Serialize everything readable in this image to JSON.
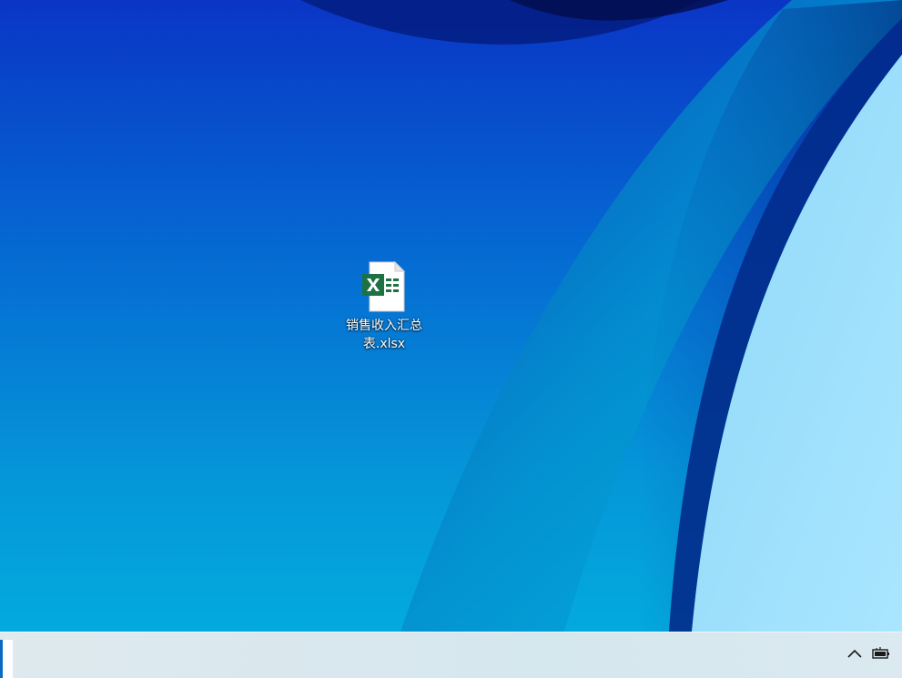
{
  "desktop": {
    "icons": [
      {
        "label": "销售收入汇总表.xlsx",
        "icon_name": "excel-file-icon",
        "brand_color": "#1e7145"
      }
    ]
  },
  "taskbar": {
    "tray": [
      {
        "icon_name": "chevron-up-icon"
      },
      {
        "icon_name": "battery-icon"
      }
    ]
  }
}
